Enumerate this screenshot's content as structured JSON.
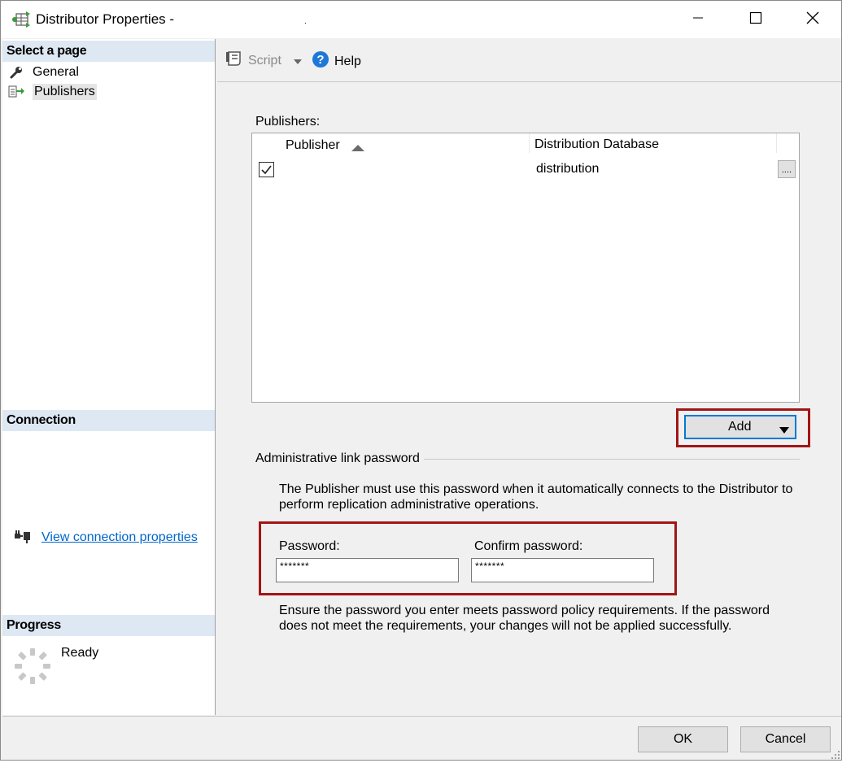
{
  "window": {
    "title": "Distributor Properties -",
    "title_suffix": "."
  },
  "left": {
    "select_page_header": "Select a page",
    "pages": [
      {
        "label": "General",
        "icon": "wrench-icon"
      },
      {
        "label": "Publishers",
        "icon": "publisher-icon",
        "selected": true
      }
    ],
    "connection_header": "Connection",
    "view_connection_link": "View connection properties",
    "progress_header": "Progress",
    "progress_status": "Ready"
  },
  "toolbar": {
    "script_label": "Script",
    "help_label": "Help"
  },
  "publishers": {
    "label": "Publishers:",
    "columns": [
      "Publisher",
      "Distribution Database"
    ],
    "rows": [
      {
        "checked": true,
        "publisher": "",
        "database": "distribution",
        "browse": "...."
      }
    ],
    "add_label": "Add"
  },
  "admin": {
    "group_title": "Administrative link password",
    "description_line1": "The Publisher must use this password when it automatically connects to the Distributor to",
    "description_line2": "perform replication administrative operations.",
    "password_label": "Password:",
    "password_value": "*******",
    "confirm_label": "Confirm password:",
    "confirm_value": "*******",
    "policy_line1": "Ensure the password you enter meets password policy requirements. If the password",
    "policy_line2": "does not meet the requirements, your changes will not be applied successfully."
  },
  "buttons": {
    "ok": "OK",
    "cancel": "Cancel"
  },
  "colors": {
    "section_header_bg": "#dde8f3",
    "highlight_border": "#a31515",
    "focus_border": "#0078d7",
    "link": "#0066cc"
  }
}
